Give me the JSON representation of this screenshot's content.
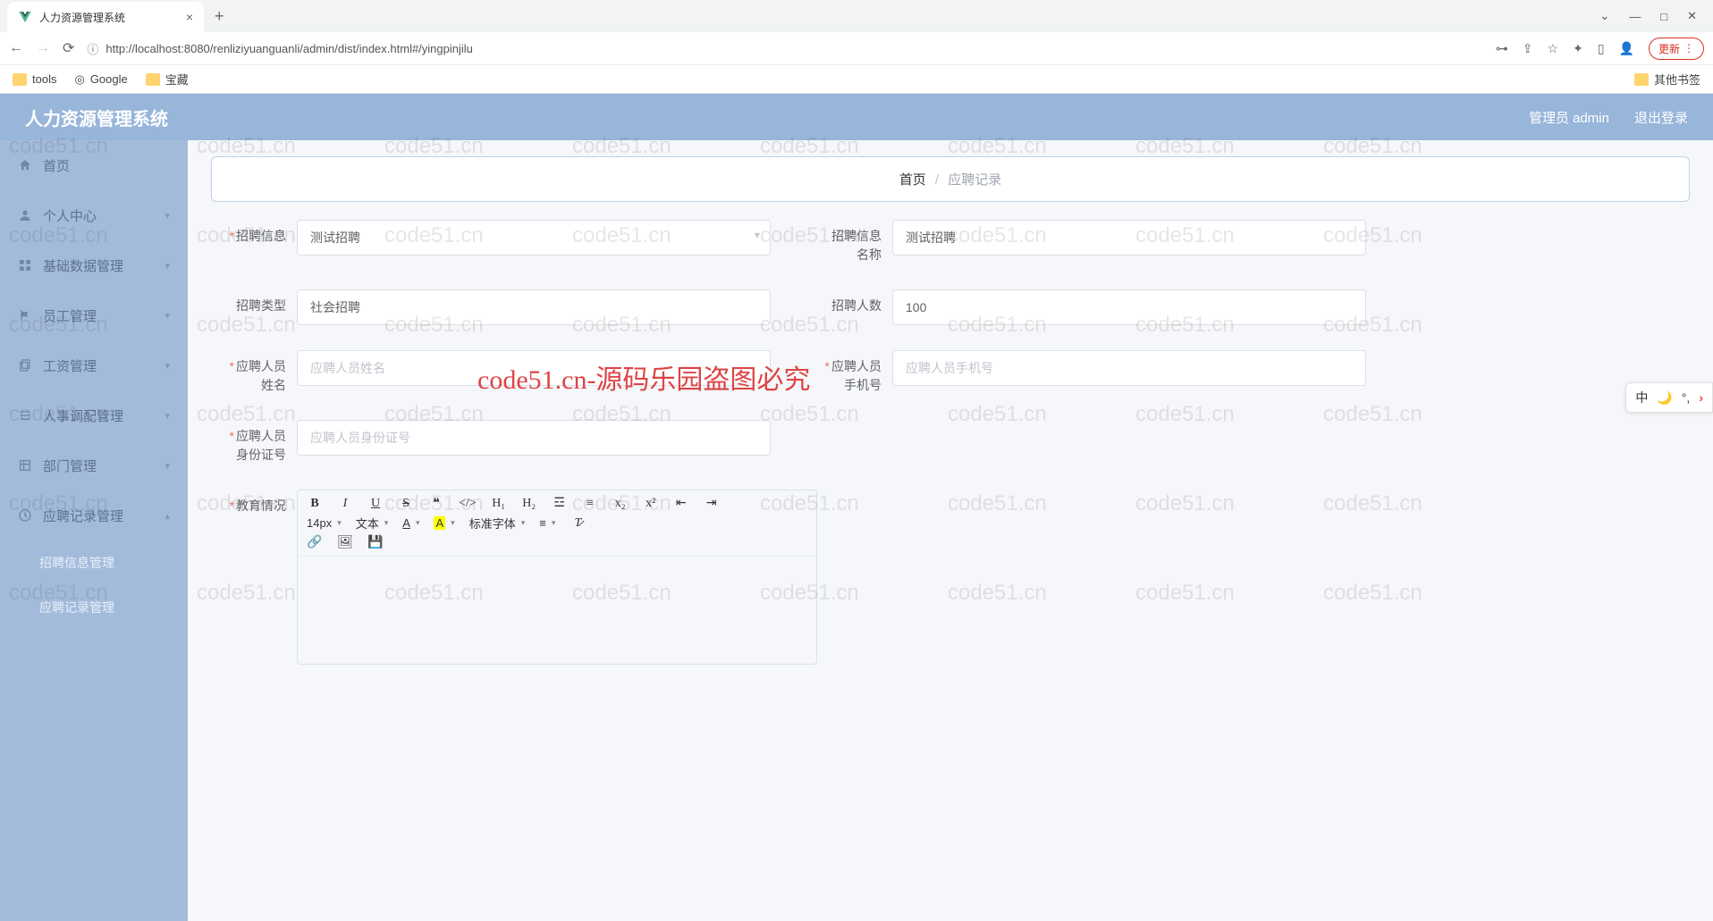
{
  "browser": {
    "tab_title": "人力资源管理系统",
    "url_info": "ⓘ",
    "url": "http://localhost:8080/renliziyuanguanli/admin/dist/index.html#/yingpinjilu",
    "update_btn": "更新",
    "bookmarks": {
      "tools": "tools",
      "google": "Google",
      "baozang": "宝藏",
      "other": "其他书签"
    }
  },
  "header": {
    "title": "人力资源管理系统",
    "admin": "管理员 admin",
    "logout": "退出登录"
  },
  "sidebar": {
    "home": "首页",
    "personal": "个人中心",
    "base": "基础数据管理",
    "employee": "员工管理",
    "salary": "工资管理",
    "hr": "人事调配管理",
    "dept": "部门管理",
    "record": "应聘记录管理",
    "sub1": "招聘信息管理",
    "sub2": "应聘记录管理"
  },
  "breadcrumb": {
    "home": "首页",
    "current": "应聘记录"
  },
  "form": {
    "f1_label1": "招聘信息",
    "f1_value": "测试招聘",
    "f2_label1": "招聘信息",
    "f2_label2": "名称",
    "f2_value": "测试招聘",
    "f3_label": "招聘类型",
    "f3_value": "社会招聘",
    "f4_label": "招聘人数",
    "f4_value": "100",
    "f5_label1": "应聘人员",
    "f5_label2": "姓名",
    "f5_placeholder": "应聘人员姓名",
    "f6_label1": "应聘人员",
    "f6_label2": "手机号",
    "f6_placeholder": "应聘人员手机号",
    "f7_label1": "应聘人员",
    "f7_label2": "身份证号",
    "f7_placeholder": "应聘人员身份证号",
    "f8_label": "教育情况",
    "editor": {
      "size": "14px",
      "wenben": "文本",
      "font": "标准字体"
    }
  },
  "float": {
    "zhong": "中"
  },
  "watermark_text": "code51.cn",
  "watermark_red": "code51.cn-源码乐园盗图必究"
}
